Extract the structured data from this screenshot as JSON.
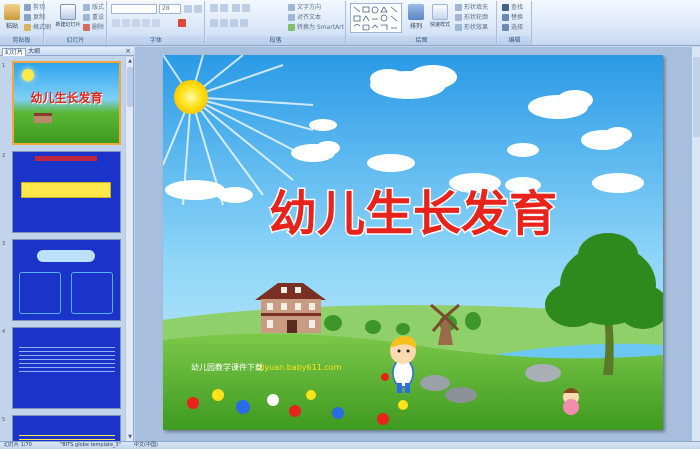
{
  "ribbon": {
    "clipboard": {
      "label": "剪贴板",
      "paste": "粘贴",
      "cut": "剪切",
      "copy": "复制",
      "format_painter": "格式刷"
    },
    "slides": {
      "label": "幻灯片",
      "new_slide": "新建幻灯片",
      "layout": "版式",
      "reset": "重设",
      "delete": "删除"
    },
    "font": {
      "label": "字体",
      "size": "28"
    },
    "paragraph": {
      "label": "段落",
      "text_direction": "文字方向",
      "align_text": "对齐文本",
      "smartart": "转换为 SmartArt"
    },
    "drawing": {
      "label": "绘图",
      "arrange": "排列",
      "quick_styles": "快速样式",
      "shape_fill": "形状填充",
      "shape_outline": "形状轮廓",
      "shape_effects": "形状效果"
    },
    "editing": {
      "label": "编辑",
      "find": "查找",
      "replace": "替换",
      "select": "选择"
    }
  },
  "panel": {
    "tabs": [
      "幻灯片",
      "大纲"
    ],
    "close": "×"
  },
  "thumbnails": [
    {
      "num": "1",
      "title": "幼儿生长发育"
    },
    {
      "num": "2",
      "heading": "",
      "text": ""
    },
    {
      "num": "3"
    },
    {
      "num": "4"
    },
    {
      "num": "5"
    }
  ],
  "slide": {
    "title": "幼儿生长发育",
    "watermark_label": "幼儿园教学课件下载",
    "watermark_url": "ziyuan.baby611.com"
  },
  "status": {
    "slide_count": "幻灯片 1/70",
    "theme": "\"BITS globe template_3\"",
    "language": "中文(中国)"
  },
  "colors": {
    "title_red": "#e8231b",
    "sky": "#4ab6f0",
    "grass": "#4fae2c",
    "selection": "#f4a83a",
    "thumb_blue": "#1a33c8"
  }
}
